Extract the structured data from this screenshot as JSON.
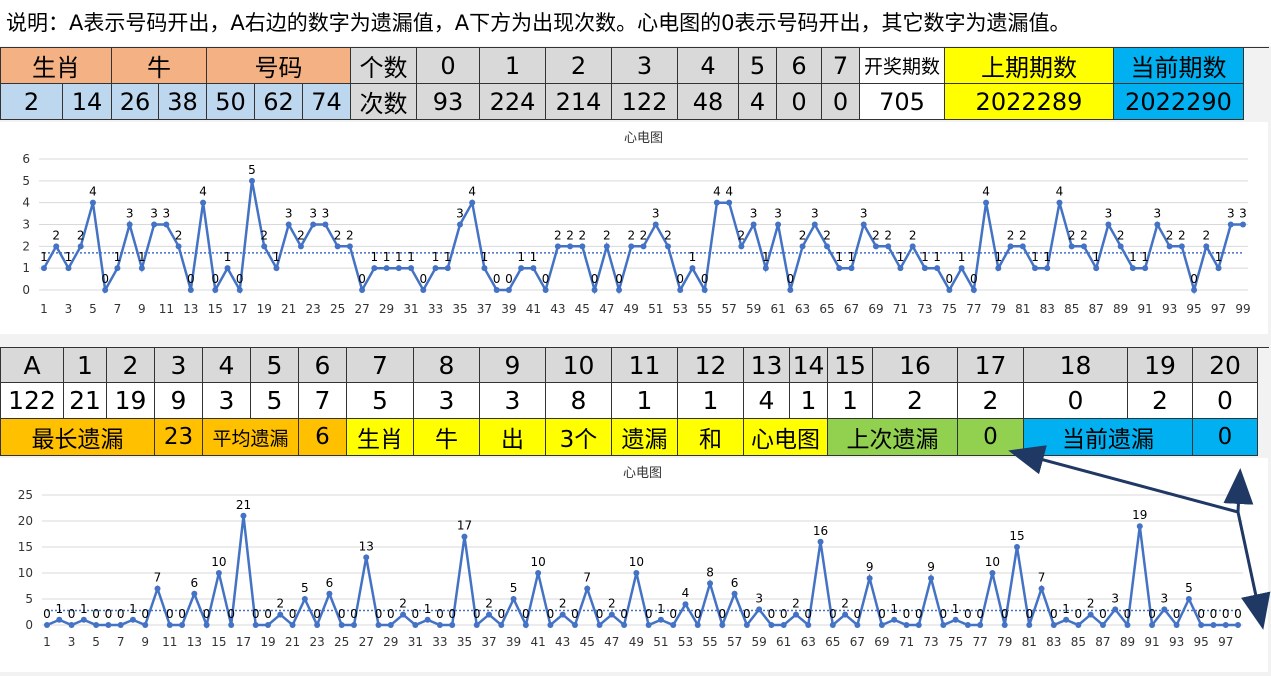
{
  "note": "说明：A表示号码开出，A右边的数字为遗漏值，A下方为出现次数。心电图的0表示号码开出，其它数字为遗漏值。",
  "table1": {
    "row1": {
      "shengxiao": "生肖",
      "niu": "牛",
      "haoma": "号码",
      "geshu": "个数",
      "counts": [
        "0",
        "1",
        "2",
        "3",
        "4",
        "5",
        "6",
        "7"
      ],
      "kaijiang": "开奖期数",
      "shangqi": "上期期数",
      "dangqian": "当前期数"
    },
    "row2": {
      "numbers": [
        "2",
        "14",
        "26",
        "38",
        "50",
        "62",
        "74"
      ],
      "cishu": "次数",
      "values": [
        "93",
        "224",
        "214",
        "122",
        "48",
        "4",
        "0",
        "0"
      ],
      "kaijiang_value": "705",
      "shangqi_value": "2022289",
      "dangqian_value": "2022290"
    }
  },
  "table2": {
    "header": [
      "A",
      "1",
      "2",
      "3",
      "4",
      "5",
      "6",
      "7",
      "8",
      "9",
      "10",
      "11",
      "12",
      "13",
      "14",
      "15",
      "16",
      "17",
      "18",
      "19",
      "20"
    ],
    "values": [
      "122",
      "21",
      "19",
      "9",
      "3",
      "5",
      "7",
      "5",
      "3",
      "3",
      "8",
      "1",
      "1",
      "4",
      "1",
      "1",
      "2",
      "2",
      "0",
      "2",
      "0"
    ],
    "row3": {
      "max_miss_label": "最长遗漏",
      "max_miss_value": "23",
      "avg_miss_label": "平均遗漏",
      "avg_miss_value": "6",
      "tags": [
        "生肖",
        "牛",
        "出",
        "3个",
        "遗漏",
        "和",
        "心电图"
      ],
      "last_miss_label": "上次遗漏",
      "last_miss_value": "0",
      "cur_miss_label": "当前遗漏",
      "cur_miss_value": "0"
    }
  },
  "colors": {
    "line": "#4472c4",
    "peach": "#f4b183",
    "lightblue": "#bdd7ee",
    "yellow": "#ffff00",
    "cyan": "#00b0f0",
    "orange": "#ffc000",
    "green": "#92d050",
    "arrow": "#1f3864"
  },
  "chart_data": [
    {
      "type": "line",
      "title": "心电图",
      "x": [
        1,
        2,
        3,
        4,
        5,
        6,
        7,
        8,
        9,
        10,
        11,
        12,
        13,
        14,
        15,
        16,
        17,
        18,
        19,
        20,
        21,
        22,
        23,
        24,
        25,
        26,
        27,
        28,
        29,
        30,
        31,
        32,
        33,
        34,
        35,
        36,
        37,
        38,
        39,
        40,
        41,
        42,
        43,
        44,
        45,
        46,
        47,
        48,
        49,
        50,
        51,
        52,
        53,
        54,
        55,
        56,
        57,
        58,
        59,
        60,
        61,
        62,
        63,
        64,
        65,
        66,
        67,
        68,
        69,
        70,
        71,
        72,
        73,
        74,
        75,
        76,
        77,
        78,
        79,
        80,
        81,
        82,
        83,
        84,
        85,
        86,
        87,
        88,
        89,
        90,
        91,
        92,
        93,
        94,
        95,
        96,
        97,
        98,
        99
      ],
      "xticks": [
        1,
        3,
        5,
        7,
        9,
        11,
        13,
        15,
        17,
        19,
        21,
        23,
        25,
        27,
        29,
        31,
        33,
        35,
        37,
        39,
        41,
        43,
        45,
        47,
        49,
        51,
        53,
        55,
        57,
        59,
        61,
        63,
        65,
        67,
        69,
        71,
        73,
        75,
        77,
        79,
        81,
        83,
        85,
        87,
        89,
        91,
        93,
        95,
        97,
        99
      ],
      "values": [
        1,
        2,
        1,
        2,
        4,
        0,
        1,
        3,
        1,
        3,
        3,
        2,
        0,
        4,
        0,
        1,
        0,
        5,
        2,
        1,
        3,
        2,
        3,
        3,
        2,
        2,
        0,
        1,
        1,
        1,
        1,
        0,
        1,
        1,
        3,
        4,
        1,
        0,
        0,
        1,
        1,
        0,
        2,
        2,
        2,
        0,
        2,
        0,
        2,
        2,
        3,
        2,
        0,
        1,
        0,
        4,
        4,
        2,
        3,
        1,
        3,
        0,
        2,
        3,
        2,
        1,
        1,
        3,
        2,
        2,
        1,
        2,
        1,
        1,
        0,
        1,
        0,
        4,
        1,
        2,
        2,
        1,
        1,
        4,
        2,
        2,
        1,
        3,
        2,
        1,
        1,
        3,
        2,
        2,
        0,
        2,
        1,
        3,
        3
      ],
      "ylim": [
        0,
        6
      ],
      "yticks": [
        0,
        1,
        2,
        3,
        4,
        5,
        6
      ],
      "average": 1.7,
      "grid": true
    },
    {
      "type": "line",
      "title": "心电图",
      "x": [
        1,
        2,
        3,
        4,
        5,
        6,
        7,
        8,
        9,
        10,
        11,
        12,
        13,
        14,
        15,
        16,
        17,
        18,
        19,
        20,
        21,
        22,
        23,
        24,
        25,
        26,
        27,
        28,
        29,
        30,
        31,
        32,
        33,
        34,
        35,
        36,
        37,
        38,
        39,
        40,
        41,
        42,
        43,
        44,
        45,
        46,
        47,
        48,
        49,
        50,
        51,
        52,
        53,
        54,
        55,
        56,
        57,
        58,
        59,
        60,
        61,
        62,
        63,
        64,
        65,
        66,
        67,
        68,
        69,
        70,
        71,
        72,
        73,
        74,
        75,
        76,
        77,
        78,
        79,
        80,
        81,
        82,
        83,
        84,
        85,
        86,
        87,
        88,
        89,
        90,
        91,
        92,
        93,
        94,
        95,
        96,
        97,
        98
      ],
      "xticks": [
        1,
        3,
        5,
        7,
        9,
        11,
        13,
        15,
        17,
        19,
        21,
        23,
        25,
        27,
        29,
        31,
        33,
        35,
        37,
        39,
        41,
        43,
        45,
        47,
        49,
        51,
        53,
        55,
        57,
        59,
        61,
        63,
        65,
        67,
        69,
        71,
        73,
        75,
        77,
        79,
        81,
        83,
        85,
        87,
        89,
        91,
        93,
        95,
        97
      ],
      "values": [
        0,
        1,
        0,
        1,
        0,
        0,
        0,
        1,
        0,
        7,
        0,
        0,
        6,
        0,
        10,
        0,
        21,
        0,
        0,
        2,
        0,
        5,
        0,
        6,
        0,
        0,
        13,
        0,
        0,
        2,
        0,
        1,
        0,
        0,
        17,
        0,
        2,
        0,
        5,
        0,
        10,
        0,
        2,
        0,
        7,
        0,
        2,
        0,
        10,
        0,
        1,
        0,
        4,
        0,
        8,
        0,
        6,
        0,
        3,
        0,
        0,
        2,
        0,
        16,
        0,
        2,
        0,
        9,
        0,
        1,
        0,
        0,
        9,
        0,
        1,
        0,
        0,
        10,
        0,
        15,
        0,
        7,
        0,
        1,
        0,
        2,
        0,
        3,
        0,
        19,
        0,
        3,
        0,
        5,
        0,
        0,
        0,
        0
      ],
      "ylim": [
        0,
        25
      ],
      "yticks": [
        0,
        5,
        10,
        15,
        20,
        25
      ],
      "average": 2.8,
      "grid": true
    }
  ]
}
